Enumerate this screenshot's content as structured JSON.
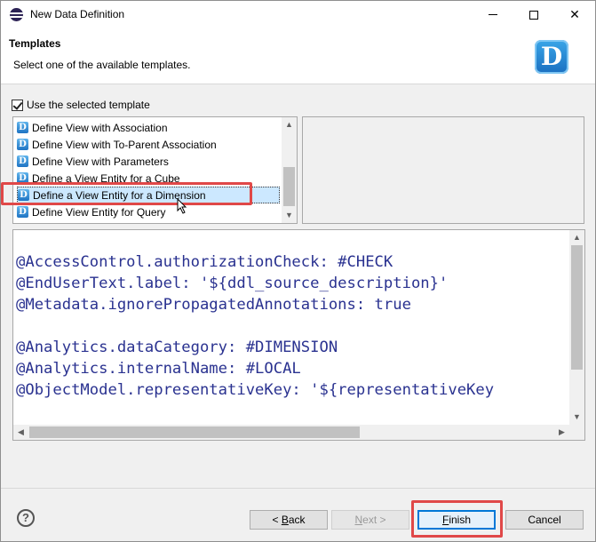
{
  "window": {
    "title": "New Data Definition",
    "minimize_icon": "minimize-icon",
    "maximize_icon": "maximize-icon",
    "close_icon": "close-icon",
    "close_glyph": "✕"
  },
  "header": {
    "title": "Templates",
    "description": "Select one of the available templates.",
    "logo_letter": "D"
  },
  "use_template": {
    "label": "Use the selected template",
    "checked": true
  },
  "templates": [
    {
      "label": "Define View with Association",
      "selected": false
    },
    {
      "label": "Define View with To-Parent Association",
      "selected": false
    },
    {
      "label": "Define View with Parameters",
      "selected": false
    },
    {
      "label": "Define a View Entity for a Cube",
      "selected": false
    },
    {
      "label": "Define a View Entity for a Dimension",
      "selected": true
    },
    {
      "label": "Define View Entity for Query",
      "selected": false
    }
  ],
  "code": {
    "lines": [
      "",
      "@AccessControl.authorizationCheck: #CHECK",
      "@EndUserText.label: '${ddl_source_description}'",
      "@Metadata.ignorePropagatedAnnotations: true",
      "",
      "@Analytics.dataCategory: #DIMENSION",
      "@Analytics.internalName: #LOCAL",
      "@ObjectModel.representativeKey: '${representativeKey"
    ]
  },
  "footer": {
    "help_glyph": "?",
    "back": {
      "prefix": "< ",
      "mnemonic": "B",
      "rest": "ack"
    },
    "next": {
      "mnemonic": "N",
      "rest": "ext >"
    },
    "finish": {
      "mnemonic": "F",
      "rest": "inish"
    },
    "cancel": "Cancel"
  },
  "colors": {
    "code_text": "#2a3290",
    "highlight": "#e04848",
    "selection": "#cce8ff"
  }
}
